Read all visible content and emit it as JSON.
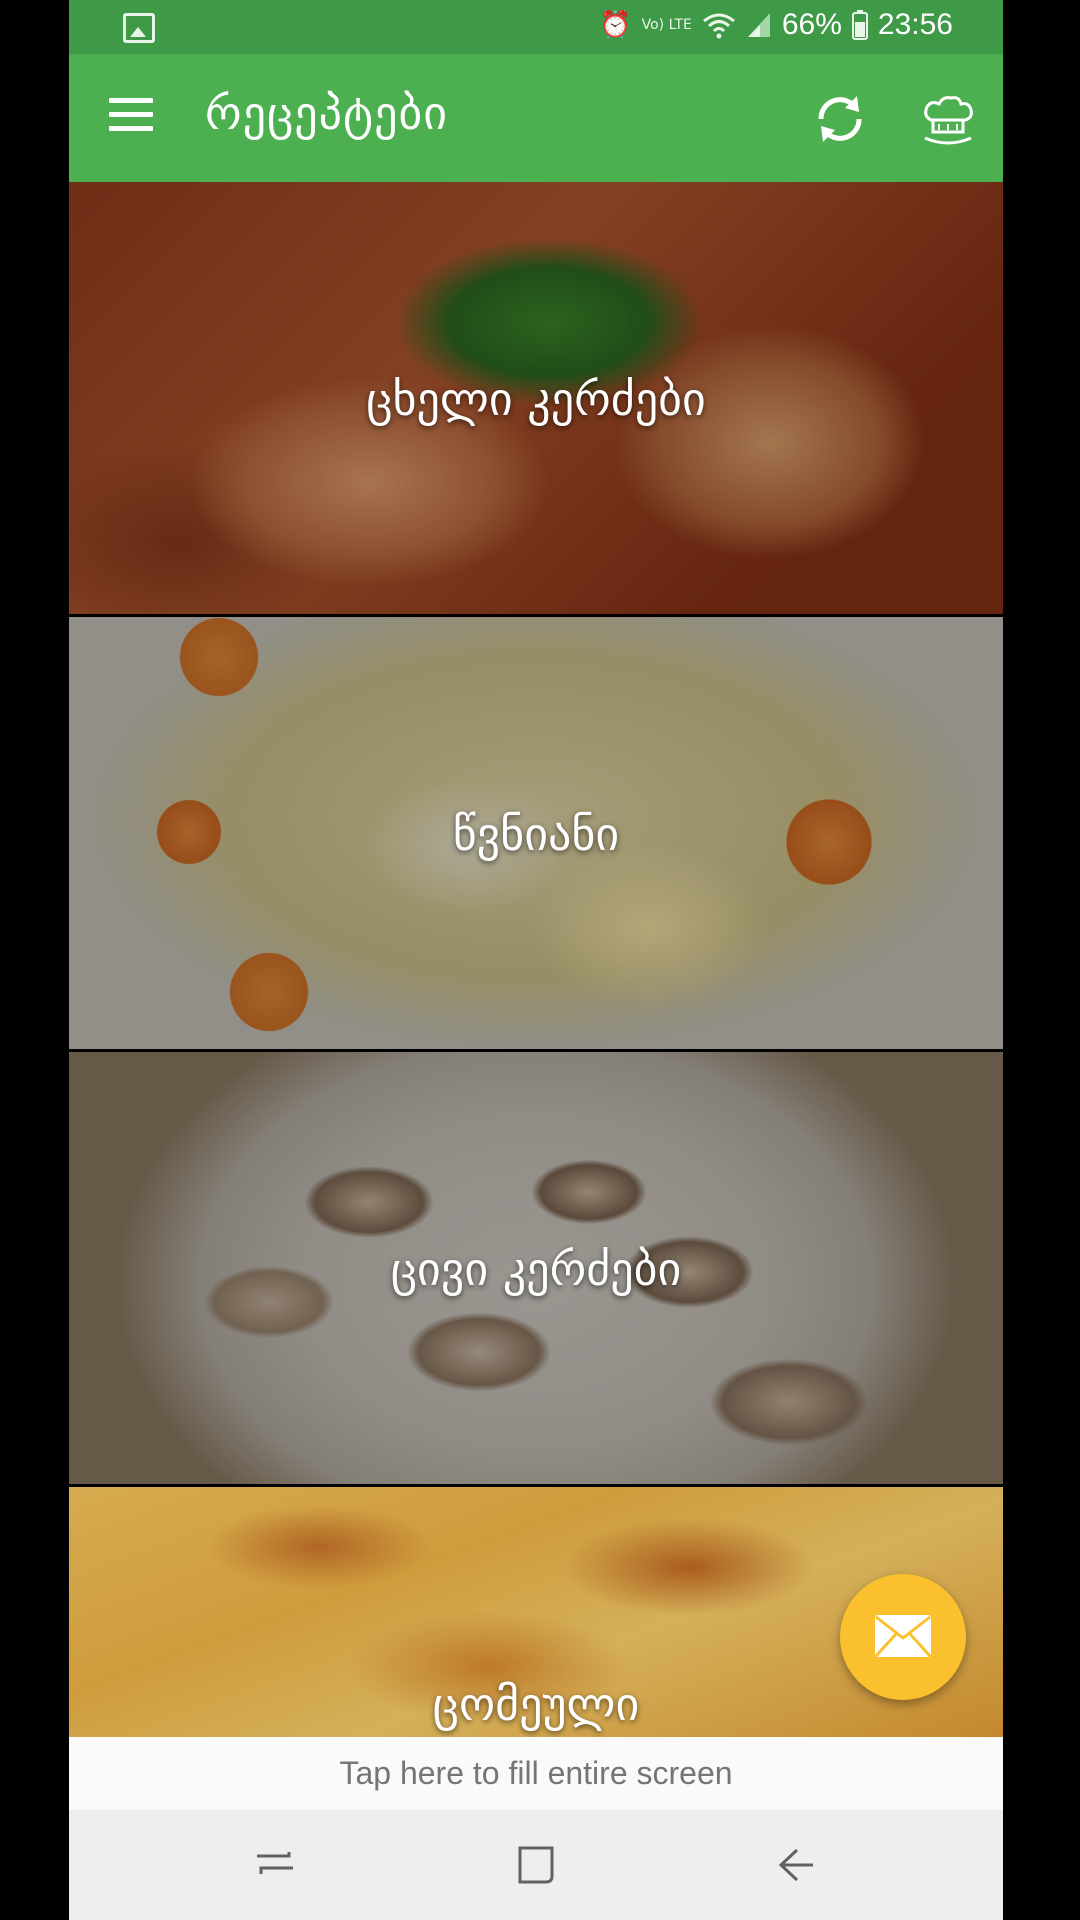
{
  "status_bar": {
    "battery": "66%",
    "time": "23:56",
    "network": "Vo) LTE",
    "icons": [
      "image-icon",
      "alarm-icon",
      "wifi-icon",
      "signal-icon",
      "battery-icon"
    ]
  },
  "app_bar": {
    "title": "რეცეპტები",
    "icons": [
      "menu-icon",
      "refresh-icon",
      "chef-hat-icon"
    ]
  },
  "categories": [
    {
      "label": "ცხელი კერძები"
    },
    {
      "label": "წვნიანი"
    },
    {
      "label": "ცივი კერძები"
    },
    {
      "label": "ცომეული"
    }
  ],
  "fab": {
    "icon": "mail-icon",
    "color": "#fbc02d"
  },
  "ad_banner": {
    "text": "Tap here to fill entire screen"
  },
  "nav_bar": {
    "icons": [
      "recent-apps-icon",
      "home-icon",
      "back-icon"
    ]
  },
  "colors": {
    "primary": "#4caf50",
    "primary_dark": "#3f9a47",
    "accent": "#fbc02d"
  }
}
